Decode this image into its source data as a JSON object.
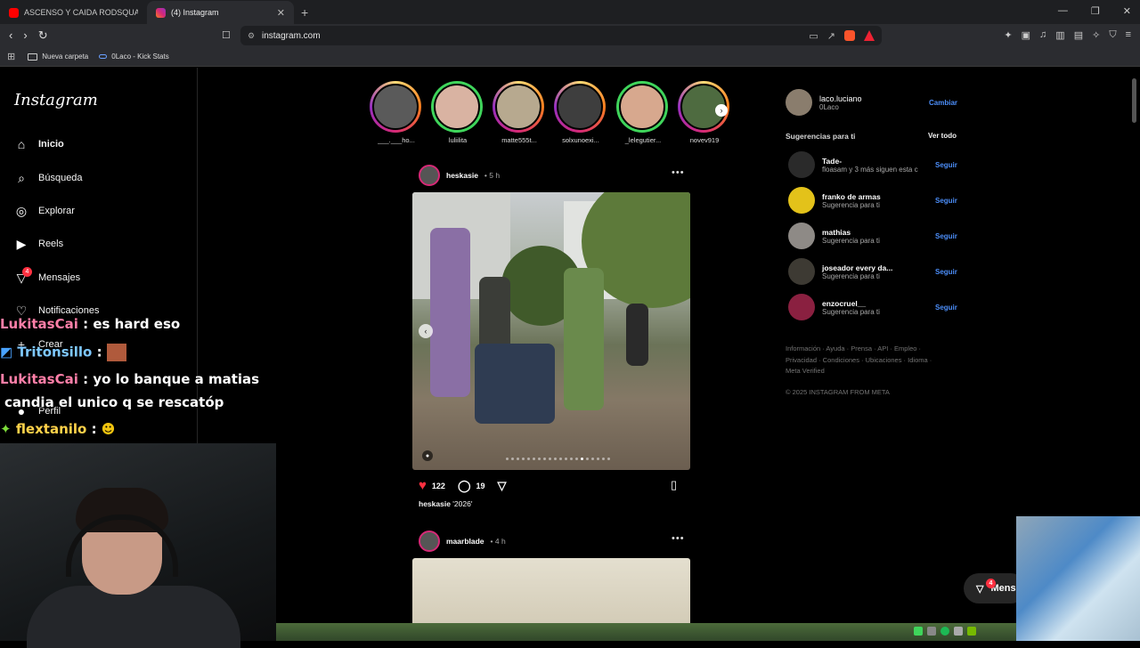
{
  "browser": {
    "tabs": [
      {
        "title": "ASCENSO Y CAIDA RODSQUARE - Yo",
        "active": false,
        "favicon_color": "#ff0000"
      },
      {
        "title": "(4) Instagram",
        "active": true,
        "favicon_color": "#d62976"
      }
    ],
    "url": "instagram.com",
    "rewards_badge": "1",
    "bookmarks": [
      {
        "label": "Nueva carpeta",
        "icon": "folder-icon"
      },
      {
        "label": "0Laco - Kick Stats",
        "icon": "kick-icon"
      }
    ]
  },
  "instagram": {
    "logo": "Instagram",
    "nav": [
      {
        "label": "Inicio",
        "icon": "home-icon"
      },
      {
        "label": "Búsqueda",
        "icon": "search-icon"
      },
      {
        "label": "Explorar",
        "icon": "compass-icon"
      },
      {
        "label": "Reels",
        "icon": "reels-icon"
      },
      {
        "label": "Mensajes",
        "icon": "messenger-icon",
        "badge": "4"
      },
      {
        "label": "Notificaciones",
        "icon": "heart-icon"
      },
      {
        "label": "Crear",
        "icon": "plus-icon"
      },
      {
        "label": "Perfil",
        "icon": "profile-icon"
      }
    ],
    "stories": [
      {
        "user": "___.___ho...",
        "ring": "gradient"
      },
      {
        "user": "luliilita",
        "ring": "green"
      },
      {
        "user": "matte555t...",
        "ring": "gradient"
      },
      {
        "user": "solxunoexi...",
        "ring": "gradient"
      },
      {
        "user": "_lelegutier...",
        "ring": "green"
      },
      {
        "user": "novev919",
        "ring": "gradient"
      }
    ],
    "posts": [
      {
        "user": "heskasie",
        "time": "• 5 h",
        "likes": "122",
        "comments": "19",
        "caption_user": "heskasie",
        "caption": "'2026'"
      },
      {
        "user": "maarblade",
        "time": "• 4 h"
      }
    ],
    "current_user": {
      "username": "laco.luciano",
      "name": "0Laco",
      "switch": "Cambiar"
    },
    "suggestions_title": "Sugerencias para ti",
    "see_all": "Ver todo",
    "suggestions": [
      {
        "user": "Tade-",
        "sub": "floasam y 3 más siguen esta c",
        "action": "Seguir"
      },
      {
        "user": "franko de armas",
        "sub": "Sugerencia para ti",
        "action": "Seguir"
      },
      {
        "user": "mathias",
        "sub": "Sugerencia para ti",
        "action": "Seguir"
      },
      {
        "user": "joseador every da...",
        "sub": "Sugerencia para ti",
        "action": "Seguir"
      },
      {
        "user": "enzocruel__",
        "sub": "Sugerencia para ti",
        "action": "Seguir"
      }
    ],
    "footer_lines": [
      "Información · Ayuda · Prensa · API · Empleo ·",
      "Privacidad · Condiciones · Ubicaciones · Idioma ·",
      "Meta Verified"
    ],
    "copyright": "© 2025 INSTAGRAM FROM META",
    "messages_pill": {
      "label": "Mens",
      "badge": "4"
    }
  },
  "stream_chat": [
    {
      "user": "LukitasCai",
      "sep": " : ",
      "text": "es hard eso"
    },
    {
      "user": "Tritonsillo",
      "sep": " : ",
      "text": ""
    },
    {
      "user": "LukitasCai",
      "sep": " : ",
      "text": "yo lo banque a matias"
    },
    {
      "user": "",
      "sep": "",
      "text": "candia el unico q se rescatóp"
    },
    {
      "user": "flextanilo",
      "sep": " : ",
      "text": ""
    }
  ]
}
